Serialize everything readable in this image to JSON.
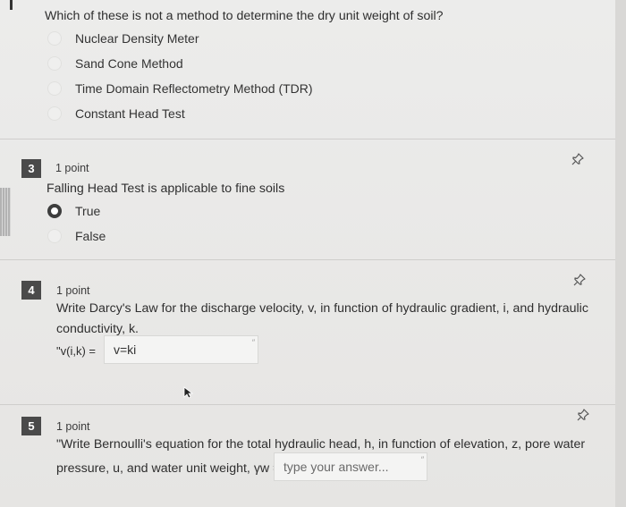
{
  "q2": {
    "text": "Which of these is not a method to determine the dry unit weight of soil?",
    "options": [
      "Nuclear Density Meter",
      "Sand Cone Method",
      "Time Domain Reflectometry Method (TDR)",
      "Constant Head Test"
    ]
  },
  "q3": {
    "number": "3",
    "points": "1 point",
    "text": "Falling Head Test is applicable to fine soils",
    "options": [
      "True",
      "False"
    ],
    "selected": "True"
  },
  "q4": {
    "number": "4",
    "points": "1 point",
    "text_line1": "Write Darcy's Law for the discharge velocity, v, in function of hydraulic gradient, i, and hydraulic",
    "text_line2": "conductivity, k.",
    "prompt_label": "\"v(i,k) =",
    "answer": "v=ki"
  },
  "q5": {
    "number": "5",
    "points": "1 point",
    "text_line1": "\"Write Bernoulli's equation for the total hydraulic head, h, in function of elevation, z, pore water",
    "text_line2": "pressure, u, and water unit weight, γw =",
    "placeholder": "type your answer..."
  },
  "icons": {
    "pin": "pin-icon",
    "cursor": "mouse-cursor-icon"
  }
}
